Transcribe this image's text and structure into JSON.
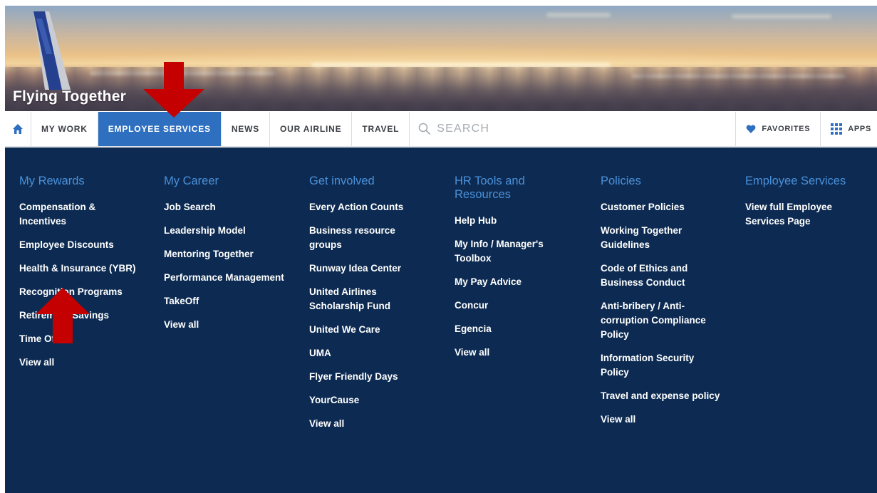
{
  "banner": {
    "title": "Flying Together"
  },
  "nav": {
    "home_icon": "home-icon",
    "items": [
      {
        "label": "MY WORK",
        "active": false
      },
      {
        "label": "EMPLOYEE SERVICES",
        "active": true
      },
      {
        "label": "NEWS",
        "active": false
      },
      {
        "label": "OUR AIRLINE",
        "active": false
      },
      {
        "label": "TRAVEL",
        "active": false
      }
    ],
    "search_placeholder": "SEARCH",
    "favorites_label": "FAVORITES",
    "apps_label": "APPS",
    "active_color": "#2e6fc0"
  },
  "menu": {
    "background": "#0d2b52",
    "heading_color": "#4a90d9",
    "columns": [
      {
        "heading": "My Rewards",
        "links": [
          "Compensation & Incentives",
          "Employee Discounts",
          "Health & Insurance (YBR)",
          "Recognition Programs",
          "Retirement Savings",
          "Time Off",
          "View all"
        ]
      },
      {
        "heading": "My Career",
        "links": [
          "Job Search",
          "Leadership Model",
          "Mentoring Together",
          "Performance Management",
          "TakeOff",
          "View all"
        ]
      },
      {
        "heading": "Get involved",
        "links": [
          "Every Action Counts",
          "Business resource groups",
          "Runway Idea Center",
          "United Airlines Scholarship Fund",
          "United We Care",
          "UMA",
          "Flyer Friendly Days",
          "YourCause",
          "View all"
        ]
      },
      {
        "heading": "HR Tools and Resources",
        "links": [
          "Help Hub",
          "My Info / Manager's Toolbox",
          "My Pay Advice",
          "Concur",
          "Egencia",
          "View all"
        ]
      },
      {
        "heading": "Policies",
        "links": [
          "Customer Policies",
          "Working Together Guidelines",
          "Code of Ethics and Business Conduct",
          "Anti-bribery / Anti-corruption Compliance Policy",
          "Information Security Policy",
          "Travel and expense policy",
          "View all"
        ]
      },
      {
        "heading": "Employee Services",
        "links": [
          "View full Employee Services Page"
        ]
      }
    ]
  },
  "annotations": {
    "arrow_color": "#c40000"
  }
}
